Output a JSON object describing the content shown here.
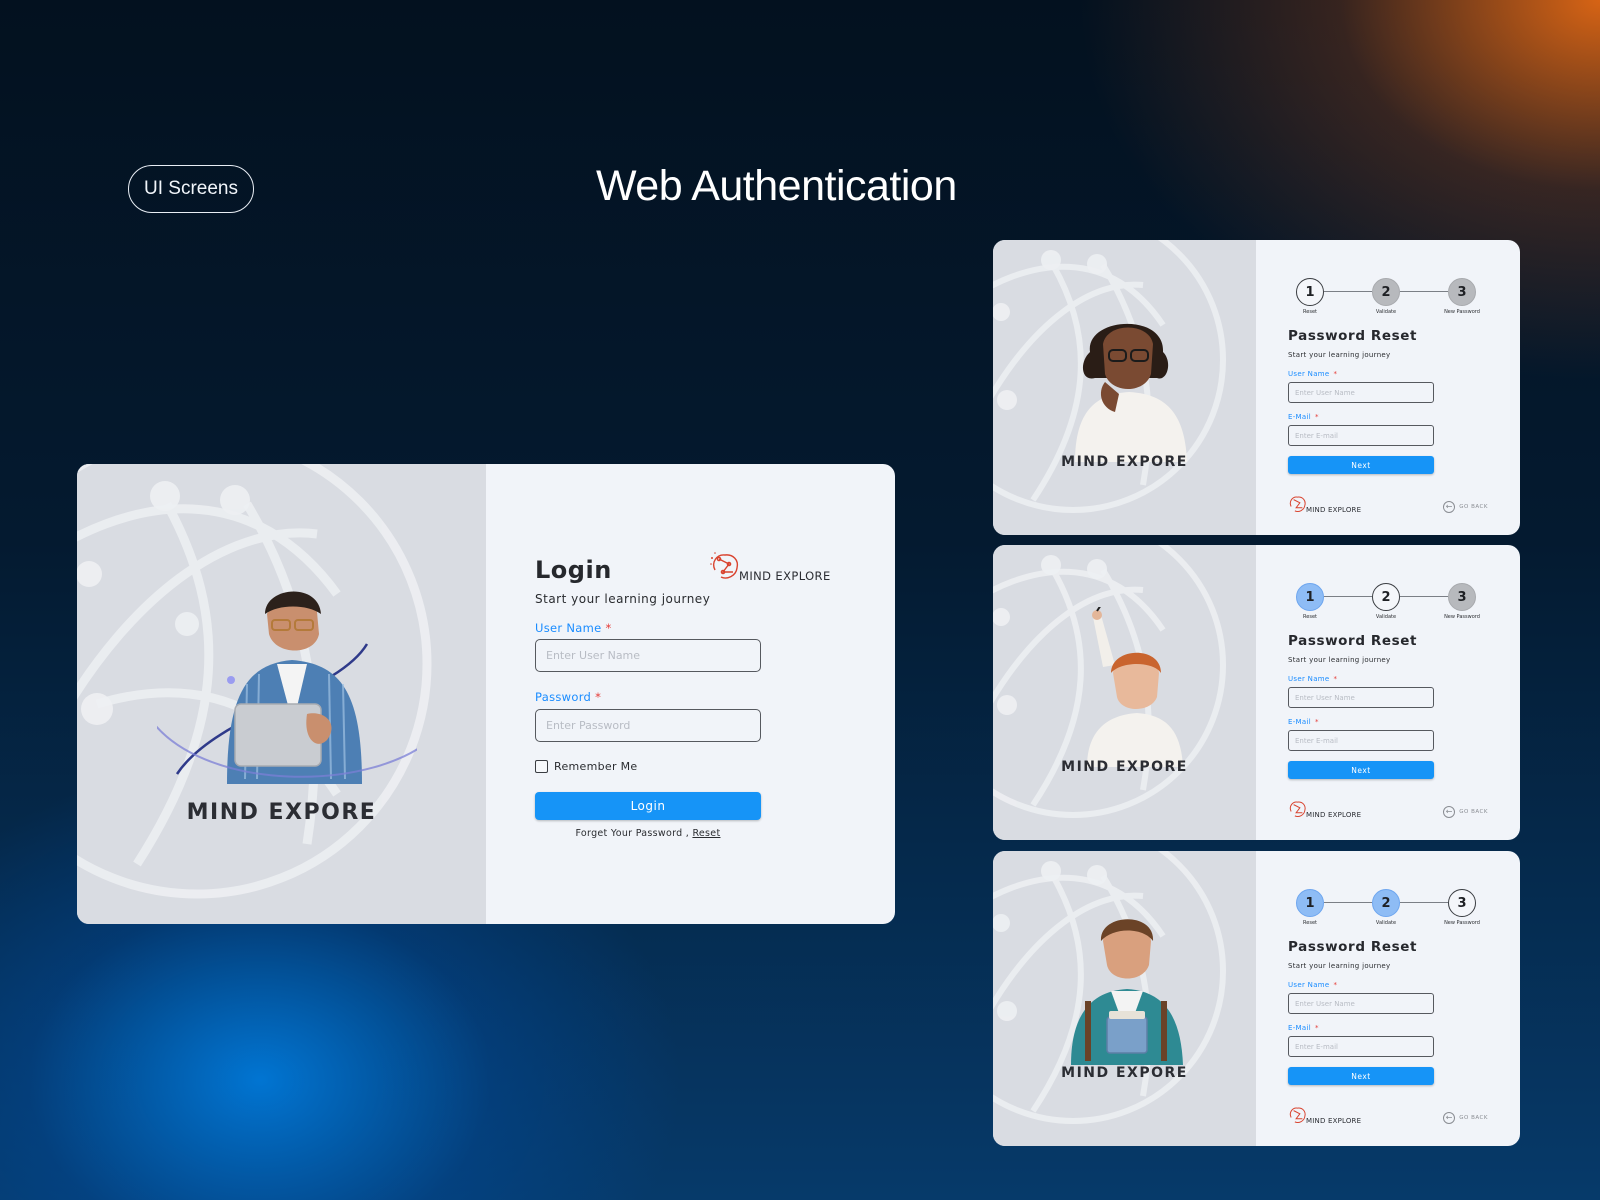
{
  "page": {
    "tag_label": "UI Screens",
    "headline": "Web Authentication"
  },
  "colors": {
    "primary": "#1694f7",
    "label_blue": "#1a8cff",
    "required_red": "#e53935",
    "step_done": "#8ebcf5",
    "step_pending": "#b7b9bd",
    "card_bg": "#f1f4f9",
    "panel_bg": "#d9dce2",
    "logo_red": "#d9432f"
  },
  "login": {
    "brand_word": "MIND EXPORE",
    "title": "Login",
    "subtitle": "Start your learning journey",
    "logo_text": "MIND EXPLORE",
    "username_label": "User Name",
    "username_placeholder": "Enter User Name",
    "password_label": "Password",
    "password_placeholder": "Enter Password",
    "required_mark": "*",
    "remember_label": "Remember Me",
    "login_button": "Login",
    "forgot_text": "Forget Your Password ,",
    "reset_link": "Reset"
  },
  "reset": {
    "brand_word": "MIND EXPORE",
    "title": "Password Reset",
    "subtitle": "Start your learning journey",
    "username_label": "User Name",
    "username_placeholder": "Enter User Name",
    "email_label": "E-Mail",
    "email_placeholder": "Enter E-mail",
    "required_mark": "*",
    "next_button": "Next",
    "logo_text": "MIND EXPLORE",
    "go_back": "GO BACK",
    "back_icon": "arrow-left-icon",
    "steps": [
      {
        "number": "1",
        "label": "Reset"
      },
      {
        "number": "2",
        "label": "Validate"
      },
      {
        "number": "3",
        "label": "New Password"
      }
    ],
    "screens": [
      {
        "step_states": [
          "active",
          "pending",
          "pending"
        ],
        "person": "girl-thinking-image"
      },
      {
        "step_states": [
          "done",
          "active",
          "pending"
        ],
        "person": "boy-raising-hand-image"
      },
      {
        "step_states": [
          "done",
          "done",
          "active"
        ],
        "person": "student-with-books-image"
      }
    ]
  }
}
